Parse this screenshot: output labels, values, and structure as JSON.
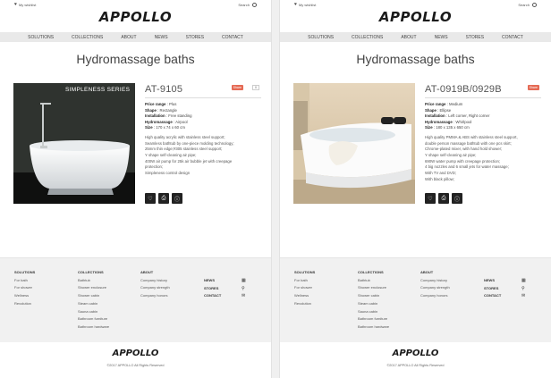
{
  "brand": "APPOLLO",
  "topbar": {
    "wishlist": "My wishlist",
    "search": "Search"
  },
  "nav": [
    "SOLUTIONS",
    "COLLECTIONS",
    "ABOUT",
    "NEWS",
    "STORES",
    "CONTACT"
  ],
  "page_title": "Hydromassage baths",
  "left_product": {
    "image_banner": "SIMPLENESS SERIES",
    "name": "AT-9105",
    "share": "Share",
    "share_count": "0",
    "specs": [
      {
        "label": "Price range",
        "value": "Plus"
      },
      {
        "label": "Shape",
        "value": "Rectangle"
      },
      {
        "label": "Installation",
        "value": "Free standing"
      },
      {
        "label": "Hydromassage",
        "value": "Airpool"
      },
      {
        "label": "Size",
        "value": "170 x 74 x 60 cm"
      }
    ],
    "description": [
      "High quality acrylic with stainless steel support;",
      "Seamless bathtub by one-piece molding technology;",
      "25mm thin edge;#305 stainless steel support;",
      "Y shape self-cleaning air pipe;",
      "400W air pump for 25k air bubble jet with creepage",
      "protection;",
      "Simpleness control design"
    ]
  },
  "right_product": {
    "name": "AT-0919B/0929B",
    "share": "Share",
    "specs": [
      {
        "label": "Price range",
        "value": "Medium"
      },
      {
        "label": "Shape",
        "value": "Ellipse"
      },
      {
        "label": "Installation",
        "value": "Left corner, Right corner"
      },
      {
        "label": "Hydromassage",
        "value": "Whirlpool"
      },
      {
        "label": "Size",
        "value": "180 x 135 x 650 cm"
      }
    ],
    "description": [
      "High quality PMMA & ABS with stainless steel support,",
      "double person massage bathtub with one pcs skirt;",
      "Chrome-plated mixer, with hand hold shower;",
      "Y shape self-cleaning air pipe;",
      "690W water pump with creepage protection;",
      "4 big nozzles and 6 small jets for water massage;",
      "With TV and DVD;",
      "With black pillow;"
    ]
  },
  "footer": {
    "solutions": {
      "title": "SOLUTIONS",
      "items": [
        "For bath",
        "For shower",
        "Wellness",
        "Revolution"
      ]
    },
    "collections": {
      "title": "COLLECTIONS",
      "items": [
        "Bathtub",
        "Shower enclosure",
        "Shower cabin",
        "Steam cabin",
        "Sauna cabin",
        "Bathroom furniture",
        "Bathroom hardware"
      ]
    },
    "about": {
      "title": "ABOUT",
      "items": [
        "Company history",
        "Company strength",
        "Company honors"
      ]
    },
    "links": [
      "NEWS",
      "STORES",
      "CONTACT"
    ],
    "copyright": "©2017 APPOLLO All Rights Reserved"
  },
  "colors": {
    "share": "#e56a54",
    "nav_bg": "#e9e9e9",
    "footer_bg": "#f1f1f1"
  }
}
